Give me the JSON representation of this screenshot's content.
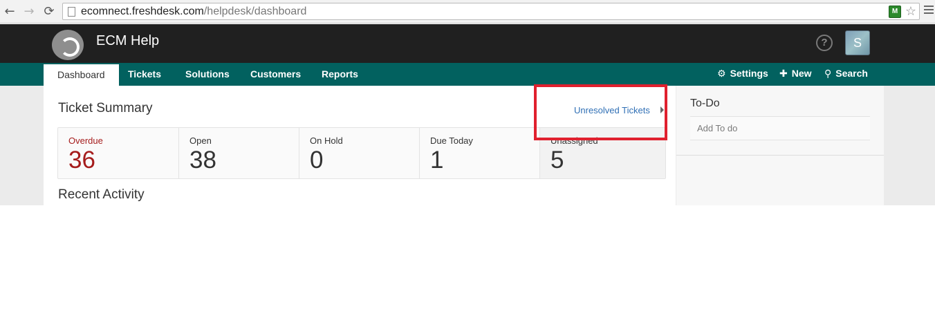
{
  "browser": {
    "url_host": "ecomnect.freshdesk.com",
    "url_path": "/helpdesk/dashboard",
    "back_icon": "←",
    "forward_icon": "→",
    "reload_icon": "⟳",
    "star_icon": "☆",
    "extension_label": "M"
  },
  "header": {
    "brand": "ECM Help",
    "help_icon": "?",
    "avatar_initial": "S"
  },
  "nav": {
    "tabs": [
      {
        "label": "Dashboard",
        "active": true
      },
      {
        "label": "Tickets"
      },
      {
        "label": "Solutions"
      },
      {
        "label": "Customers"
      },
      {
        "label": "Reports"
      }
    ],
    "settings_label": "Settings",
    "new_label": "New",
    "search_label": "Search",
    "settings_icon": "⚙",
    "new_icon": "✚",
    "search_icon": "⚲"
  },
  "main": {
    "title": "Ticket Summary",
    "unresolved_link": "Unresolved Tickets",
    "summary": [
      {
        "label": "Overdue",
        "value": "36",
        "accent": "#a51c1c"
      },
      {
        "label": "Open",
        "value": "38"
      },
      {
        "label": "On Hold",
        "value": "0"
      },
      {
        "label": "Due Today",
        "value": "1"
      },
      {
        "label": "Unassigned",
        "value": "5",
        "highlighted": true,
        "highlight_color": "#e0202e"
      }
    ],
    "recent_title": "Recent Activity"
  },
  "todo": {
    "title": "To-Do",
    "placeholder": "Add To do"
  },
  "colors": {
    "header_dark": "#202020",
    "nav_teal": "#02615f",
    "link_blue": "#2f6fb5"
  }
}
